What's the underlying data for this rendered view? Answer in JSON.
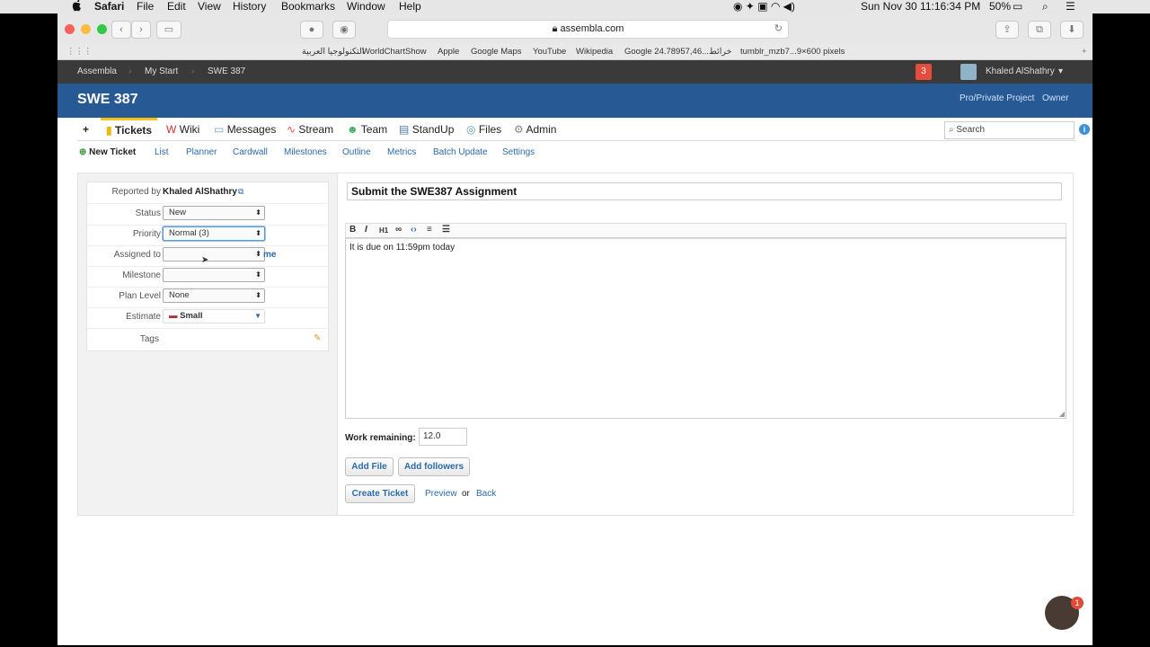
{
  "menubar": {
    "apple": "",
    "app": "Safari",
    "items": [
      "File",
      "Edit",
      "View",
      "History",
      "Bookmarks",
      "Window",
      "Help"
    ],
    "clock": "Sun Nov 30  11:16:34 PM",
    "battery": "50%"
  },
  "browser": {
    "url": "assembla.com",
    "favorites": [
      "التكنولوجيا العربية",
      "WorldChartShow",
      "Apple",
      "Google Maps",
      "YouTube",
      "Wikipedia",
      "Google خرائط...24.78957,46",
      "tumblr_mzb7...9×600 pixels"
    ]
  },
  "topnav": {
    "crumbs": [
      "Assembla",
      "My Start",
      "SWE 387"
    ],
    "notifications": "3",
    "user": "Khaled AlShathry"
  },
  "header": {
    "title": "SWE 387",
    "links": [
      "Pro/Private Project",
      "Owner"
    ]
  },
  "tabs": {
    "plus": "+",
    "items": [
      "Tickets",
      "Wiki",
      "Messages",
      "Stream",
      "Team",
      "StandUp",
      "Files",
      "Admin"
    ],
    "search_placeholder": "Search"
  },
  "subnav": {
    "new_ticket": "New Ticket",
    "links": [
      "List",
      "Planner",
      "Cardwall",
      "Milestones",
      "Outline",
      "Metrics",
      "Batch Update",
      "Settings"
    ]
  },
  "form": {
    "reported_by_label": "Reported by",
    "reported_by_value": "Khaled AlShathry",
    "status_label": "Status",
    "status_value": "New",
    "priority_label": "Priority",
    "priority_value": "Normal (3)",
    "assigned_label": "Assigned to",
    "assigned_value": "",
    "me_link": "me",
    "milestone_label": "Milestone",
    "milestone_value": "",
    "plan_label": "Plan Level",
    "plan_value": "None",
    "estimate_label": "Estimate",
    "estimate_value": "Small",
    "tags_label": "Tags"
  },
  "ticket": {
    "title": "Submit the SWE387 Assignment",
    "toolbar": [
      "B",
      "I",
      "H1",
      "link",
      "code",
      "ol",
      "ul"
    ],
    "body": "It is due on 11:59pm today",
    "work_remaining_label": "Work remaining:",
    "work_remaining_value": "12.0",
    "add_file": "Add File",
    "add_followers": "Add followers",
    "create": "Create Ticket",
    "preview": "Preview",
    "or": "or",
    "back": "Back"
  },
  "chat": {
    "badge": "1"
  }
}
